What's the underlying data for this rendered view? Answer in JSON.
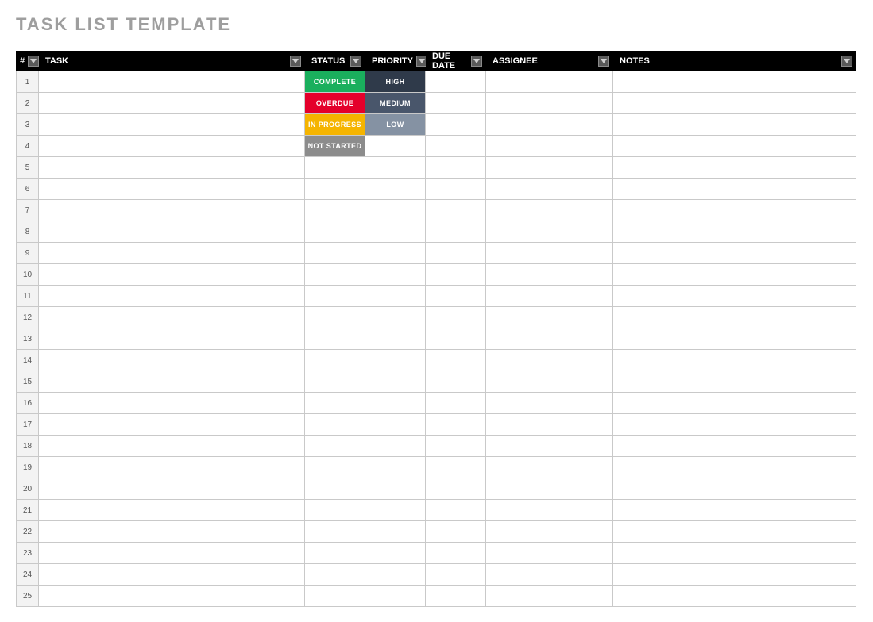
{
  "title": "TASK LIST TEMPLATE",
  "headers": {
    "num": "#",
    "task": "TASK",
    "status": "STATUS",
    "priority": "PRIORITY",
    "due": "DUE DATE",
    "assignee": "ASSIGNEE",
    "notes": "NOTES"
  },
  "rows": [
    {
      "n": "1",
      "task": "",
      "status": "COMPLETE",
      "status_class": "tag-complete",
      "priority": "HIGH",
      "priority_class": "tag-high",
      "due": "",
      "assignee": "",
      "notes": ""
    },
    {
      "n": "2",
      "task": "",
      "status": "OVERDUE",
      "status_class": "tag-overdue",
      "priority": "MEDIUM",
      "priority_class": "tag-medium",
      "due": "",
      "assignee": "",
      "notes": ""
    },
    {
      "n": "3",
      "task": "",
      "status": "IN PROGRESS",
      "status_class": "tag-inprogress",
      "priority": "LOW",
      "priority_class": "tag-low",
      "due": "",
      "assignee": "",
      "notes": ""
    },
    {
      "n": "4",
      "task": "",
      "status": "NOT STARTED",
      "status_class": "tag-notstarted",
      "priority": "",
      "priority_class": "",
      "due": "",
      "assignee": "",
      "notes": ""
    },
    {
      "n": "5",
      "task": "",
      "status": "",
      "status_class": "",
      "priority": "",
      "priority_class": "",
      "due": "",
      "assignee": "",
      "notes": ""
    },
    {
      "n": "6",
      "task": "",
      "status": "",
      "status_class": "",
      "priority": "",
      "priority_class": "",
      "due": "",
      "assignee": "",
      "notes": ""
    },
    {
      "n": "7",
      "task": "",
      "status": "",
      "status_class": "",
      "priority": "",
      "priority_class": "",
      "due": "",
      "assignee": "",
      "notes": ""
    },
    {
      "n": "8",
      "task": "",
      "status": "",
      "status_class": "",
      "priority": "",
      "priority_class": "",
      "due": "",
      "assignee": "",
      "notes": ""
    },
    {
      "n": "9",
      "task": "",
      "status": "",
      "status_class": "",
      "priority": "",
      "priority_class": "",
      "due": "",
      "assignee": "",
      "notes": ""
    },
    {
      "n": "10",
      "task": "",
      "status": "",
      "status_class": "",
      "priority": "",
      "priority_class": "",
      "due": "",
      "assignee": "",
      "notes": ""
    },
    {
      "n": "11",
      "task": "",
      "status": "",
      "status_class": "",
      "priority": "",
      "priority_class": "",
      "due": "",
      "assignee": "",
      "notes": ""
    },
    {
      "n": "12",
      "task": "",
      "status": "",
      "status_class": "",
      "priority": "",
      "priority_class": "",
      "due": "",
      "assignee": "",
      "notes": ""
    },
    {
      "n": "13",
      "task": "",
      "status": "",
      "status_class": "",
      "priority": "",
      "priority_class": "",
      "due": "",
      "assignee": "",
      "notes": ""
    },
    {
      "n": "14",
      "task": "",
      "status": "",
      "status_class": "",
      "priority": "",
      "priority_class": "",
      "due": "",
      "assignee": "",
      "notes": ""
    },
    {
      "n": "15",
      "task": "",
      "status": "",
      "status_class": "",
      "priority": "",
      "priority_class": "",
      "due": "",
      "assignee": "",
      "notes": ""
    },
    {
      "n": "16",
      "task": "",
      "status": "",
      "status_class": "",
      "priority": "",
      "priority_class": "",
      "due": "",
      "assignee": "",
      "notes": ""
    },
    {
      "n": "17",
      "task": "",
      "status": "",
      "status_class": "",
      "priority": "",
      "priority_class": "",
      "due": "",
      "assignee": "",
      "notes": ""
    },
    {
      "n": "18",
      "task": "",
      "status": "",
      "status_class": "",
      "priority": "",
      "priority_class": "",
      "due": "",
      "assignee": "",
      "notes": ""
    },
    {
      "n": "19",
      "task": "",
      "status": "",
      "status_class": "",
      "priority": "",
      "priority_class": "",
      "due": "",
      "assignee": "",
      "notes": ""
    },
    {
      "n": "20",
      "task": "",
      "status": "",
      "status_class": "",
      "priority": "",
      "priority_class": "",
      "due": "",
      "assignee": "",
      "notes": ""
    },
    {
      "n": "21",
      "task": "",
      "status": "",
      "status_class": "",
      "priority": "",
      "priority_class": "",
      "due": "",
      "assignee": "",
      "notes": ""
    },
    {
      "n": "22",
      "task": "",
      "status": "",
      "status_class": "",
      "priority": "",
      "priority_class": "",
      "due": "",
      "assignee": "",
      "notes": ""
    },
    {
      "n": "23",
      "task": "",
      "status": "",
      "status_class": "",
      "priority": "",
      "priority_class": "",
      "due": "",
      "assignee": "",
      "notes": ""
    },
    {
      "n": "24",
      "task": "",
      "status": "",
      "status_class": "",
      "priority": "",
      "priority_class": "",
      "due": "",
      "assignee": "",
      "notes": ""
    },
    {
      "n": "25",
      "task": "",
      "status": "",
      "status_class": "",
      "priority": "",
      "priority_class": "",
      "due": "",
      "assignee": "",
      "notes": ""
    }
  ]
}
